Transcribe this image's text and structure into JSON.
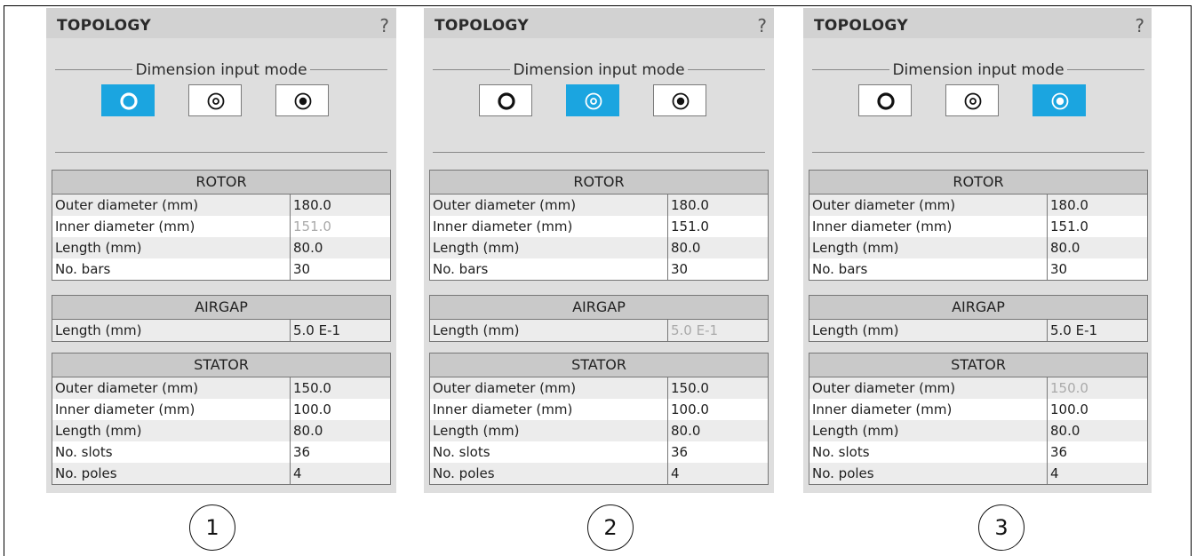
{
  "panels": [
    {
      "title": "TOPOLOGY",
      "help": "?",
      "mode_label": "Dimension input mode",
      "active_mode": 0,
      "rotor": {
        "head": "ROTOR",
        "rows": [
          {
            "label": "Outer diameter (mm)",
            "value": "180.0"
          },
          {
            "label": "Inner diameter (mm)",
            "value": "151.0"
          },
          {
            "label": "Length (mm)",
            "value": "80.0"
          },
          {
            "label": "No. bars",
            "value": "30"
          }
        ]
      },
      "airgap": {
        "head": "AIRGAP",
        "rows": [
          {
            "label": "Length (mm)",
            "value": "5.0 E-1"
          }
        ]
      },
      "stator": {
        "head": "STATOR",
        "rows": [
          {
            "label": "Outer diameter (mm)",
            "value": "150.0"
          },
          {
            "label": "Inner diameter (mm)",
            "value": "100.0"
          },
          {
            "label": "Length (mm)",
            "value": "80.0"
          },
          {
            "label": "No. slots",
            "value": "36"
          },
          {
            "label": "No. poles",
            "value": "4"
          }
        ]
      },
      "number": "1"
    },
    {
      "title": "TOPOLOGY",
      "help": "?",
      "mode_label": "Dimension input mode",
      "active_mode": 1,
      "rotor": {
        "head": "ROTOR",
        "rows": [
          {
            "label": "Outer diameter (mm)",
            "value": "180.0"
          },
          {
            "label": "Inner diameter (mm)",
            "value": "151.0"
          },
          {
            "label": "Length (mm)",
            "value": "80.0"
          },
          {
            "label": "No. bars",
            "value": "30"
          }
        ]
      },
      "airgap": {
        "head": "AIRGAP",
        "rows": [
          {
            "label": "Length (mm)",
            "value": "5.0 E-1"
          }
        ]
      },
      "stator": {
        "head": "STATOR",
        "rows": [
          {
            "label": "Outer diameter (mm)",
            "value": "150.0"
          },
          {
            "label": "Inner diameter (mm)",
            "value": "100.0"
          },
          {
            "label": "Length (mm)",
            "value": "80.0"
          },
          {
            "label": "No. slots",
            "value": "36"
          },
          {
            "label": "No. poles",
            "value": "4"
          }
        ]
      },
      "number": "2"
    },
    {
      "title": "TOPOLOGY",
      "help": "?",
      "mode_label": "Dimension input mode",
      "active_mode": 2,
      "rotor": {
        "head": "ROTOR",
        "rows": [
          {
            "label": "Outer diameter (mm)",
            "value": "180.0"
          },
          {
            "label": "Inner diameter (mm)",
            "value": "151.0"
          },
          {
            "label": "Length (mm)",
            "value": "80.0"
          },
          {
            "label": "No. bars",
            "value": "30"
          }
        ]
      },
      "airgap": {
        "head": "AIRGAP",
        "rows": [
          {
            "label": "Length (mm)",
            "value": "5.0 E-1"
          }
        ]
      },
      "stator": {
        "head": "STATOR",
        "rows": [
          {
            "label": "Outer diameter (mm)",
            "value": "150.0"
          },
          {
            "label": "Inner diameter (mm)",
            "value": "100.0"
          },
          {
            "label": "Length (mm)",
            "value": "80.0"
          },
          {
            "label": "No. slots",
            "value": "36"
          },
          {
            "label": "No. poles",
            "value": "4"
          }
        ]
      },
      "number": "3"
    }
  ],
  "icons": [
    "ring-outer-icon",
    "ring-dot-icon",
    "ring-filled-icon"
  ],
  "colors": {
    "accent": "#1ba5e0",
    "panel_bg": "#dedede",
    "header_bg": "#d2d2d2",
    "section_head_bg": "#c9c9c9",
    "derived_text": "#aaaaaa"
  }
}
